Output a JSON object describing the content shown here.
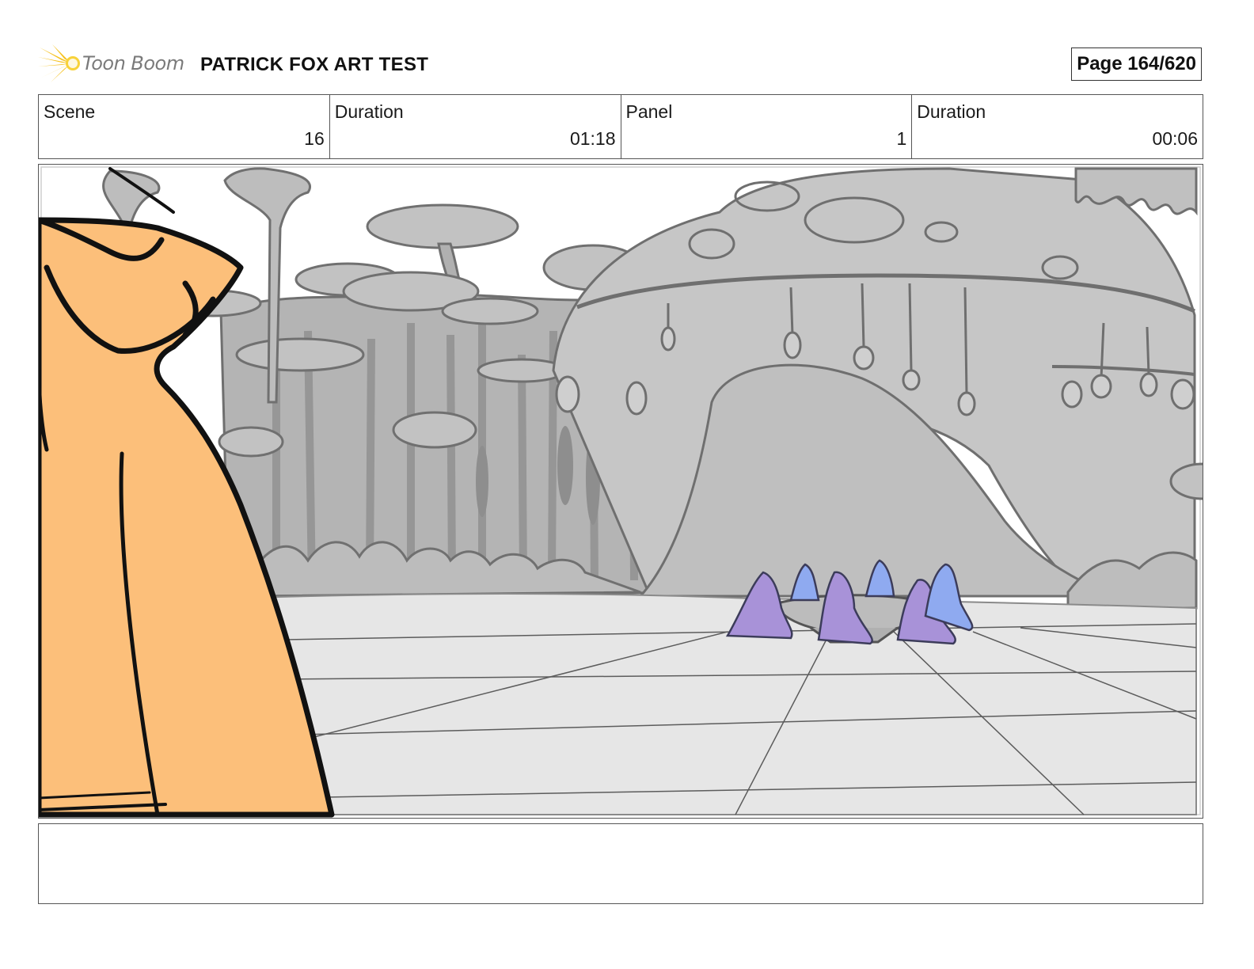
{
  "header": {
    "logo_text": "Toon Boom",
    "project_title": "PATRICK FOX ART TEST",
    "page_label": "Page 164/620"
  },
  "info": [
    {
      "label": "Scene",
      "value": "16"
    },
    {
      "label": "Duration",
      "value": "01:18"
    },
    {
      "label": "Panel",
      "value": "1"
    },
    {
      "label": "Duration",
      "value": "00:06"
    }
  ],
  "panel": {
    "colors": {
      "character_orange": "#fcbf7a",
      "background_grey": "#b4b4b4",
      "floor_grey": "#e6e6e6",
      "figure_purple": "#a892d8",
      "figure_blue": "#8faaf0"
    }
  },
  "notes": {
    "text": ""
  }
}
